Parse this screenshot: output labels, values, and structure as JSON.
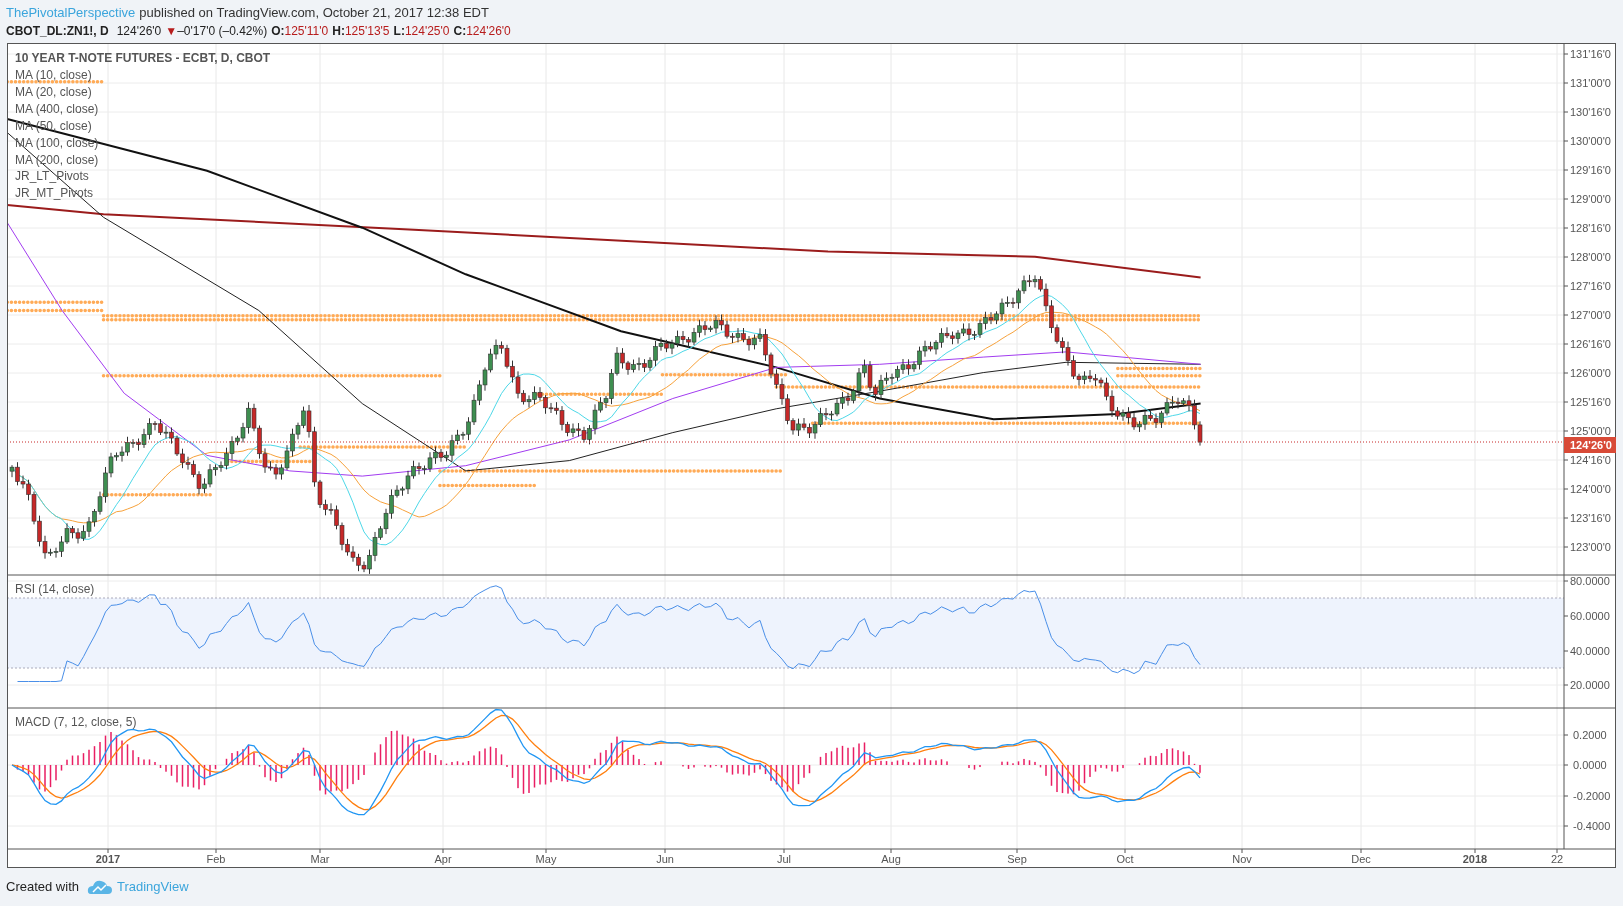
{
  "header": {
    "author": "ThePivotalPerspective",
    "published": "published on TradingView.com, October 21, 2017 12:38 EDT"
  },
  "quote": {
    "symbol": "CBOT_DL:ZN1!, D",
    "last": "124'26'0",
    "arrow": "▼",
    "change": "–0'17'0 (–0.42%)",
    "ohlc": [
      {
        "label": "O:",
        "value": "125'11'0"
      },
      {
        "label": "H:",
        "value": "125'13'5"
      },
      {
        "label": "L:",
        "value": "124'25'0"
      },
      {
        "label": "C:",
        "value": "124'26'0"
      }
    ]
  },
  "main_pane": {
    "title": "10 YEAR T-NOTE FUTURES - ECBT, D, CBOT",
    "legend": [
      "MA (10, close)",
      "MA (20, close)",
      "MA (400, close)",
      "MA (50, close)",
      "MA (100, close)",
      "MA (200, close)",
      "JR_LT_Pivots",
      "JR_MT_Pivots"
    ],
    "price_ticks": [
      "131'16'0",
      "131'00'0",
      "130'16'0",
      "130'00'0",
      "129'16'0",
      "129'00'0",
      "128'16'0",
      "128'00'0",
      "127'16'0",
      "127'00'0",
      "126'16'0",
      "126'00'0",
      "125'16'0",
      "125'00'0",
      "124'16'0",
      "124'00'0",
      "123'16'0",
      "123'00'0"
    ],
    "last_price_label": "124'26'0"
  },
  "rsi_pane": {
    "title": "RSI (14, close)",
    "ticks": [
      "80.0000",
      "60.0000",
      "40.0000",
      "20.0000"
    ]
  },
  "macd_pane": {
    "title": "MACD (7, 12, close, 5)",
    "ticks": [
      "0.2000",
      "0.0000",
      "-0.2000",
      "-0.4000"
    ]
  },
  "time_axis": [
    {
      "label": "2017",
      "kind": "year"
    },
    {
      "label": "Feb",
      "kind": "month"
    },
    {
      "label": "Mar",
      "kind": "month"
    },
    {
      "label": "Apr",
      "kind": "month"
    },
    {
      "label": "May",
      "kind": "month"
    },
    {
      "label": "Jun",
      "kind": "month"
    },
    {
      "label": "Jul",
      "kind": "month"
    },
    {
      "label": "Aug",
      "kind": "month"
    },
    {
      "label": "Sep",
      "kind": "month"
    },
    {
      "label": "Oct",
      "kind": "month"
    },
    {
      "label": "Nov",
      "kind": "month"
    },
    {
      "label": "Dec",
      "kind": "month"
    },
    {
      "label": "2018",
      "kind": "year"
    },
    {
      "label": "22",
      "kind": "day"
    }
  ],
  "footer": {
    "text": "Created with",
    "brand": "TradingView"
  }
}
